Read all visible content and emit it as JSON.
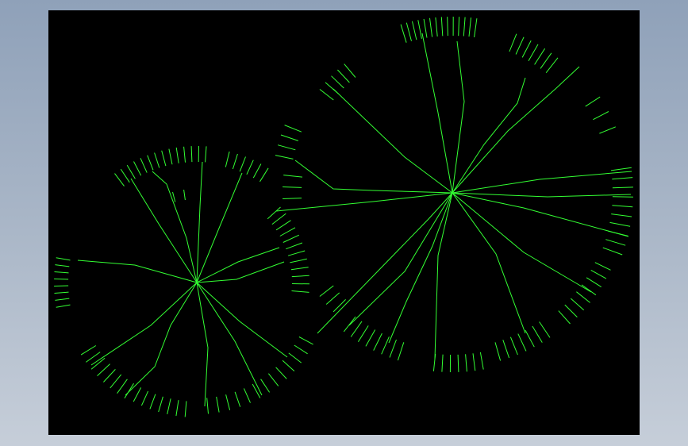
{
  "colors": {
    "background_gradient_top": "#8fa1b9",
    "background_gradient_bottom": "#c6ced9",
    "viewport": "#000000",
    "strokes": "#33ff33"
  },
  "diagram": {
    "type": "radial-branching-structures",
    "cluster_count": 2,
    "clusters": [
      {
        "name": "left-cluster",
        "branch_lines": 12,
        "tick_groups": 8
      },
      {
        "name": "right-cluster",
        "branch_lines": 16,
        "tick_groups": 12
      }
    ]
  }
}
